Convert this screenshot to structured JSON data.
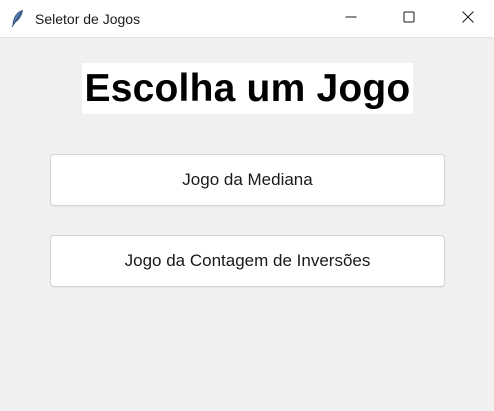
{
  "window": {
    "title": "Seletor de Jogos",
    "controls": {
      "minimize_icon": "minimize-icon",
      "maximize_icon": "maximize-icon",
      "close_icon": "close-icon"
    }
  },
  "main": {
    "heading": "Escolha um Jogo",
    "buttons": [
      {
        "label": "Jogo da Mediana"
      },
      {
        "label": "Jogo da Contagem de Inversões"
      }
    ]
  },
  "colors": {
    "background": "#f0f0f0",
    "titlebar": "#ffffff",
    "heading_bg": "#ffffff",
    "button_bg": "#ffffff",
    "button_border": "#d4d4d4"
  }
}
